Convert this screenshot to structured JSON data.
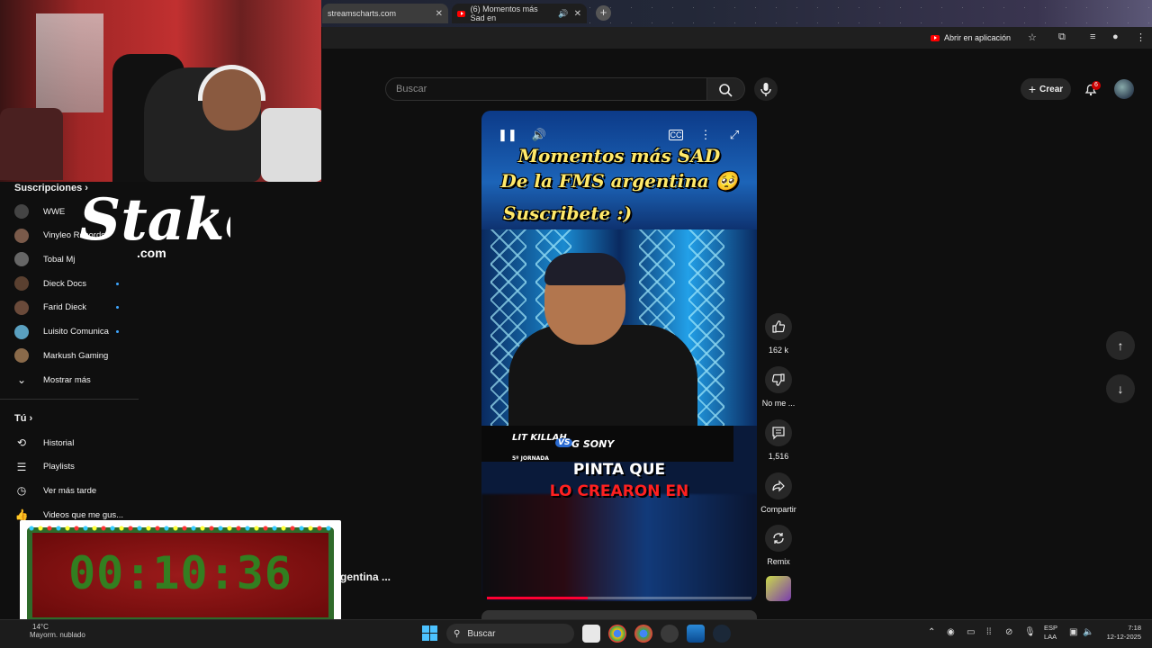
{
  "browser": {
    "tabs": [
      {
        "label": "streamscharts.com"
      },
      {
        "label": "(6) Momentos más Sad en"
      }
    ],
    "open_in_app": "Abrir en aplicación"
  },
  "header": {
    "search_placeholder": "Buscar",
    "create_label": "Crear",
    "notifications_count": "6"
  },
  "sidebar": {
    "subscriptions_title": "Suscripciones",
    "subscriptions": [
      {
        "label": "WWE",
        "new": false,
        "color": "#444"
      },
      {
        "label": "Vinyleo Records",
        "new": false,
        "color": "#7a5a4a"
      },
      {
        "label": "Tobal Mj",
        "new": false,
        "color": "#666"
      },
      {
        "label": "Dieck Docs",
        "new": true,
        "color": "#5a4030"
      },
      {
        "label": "Farid Dieck",
        "new": true,
        "color": "#6a4a3a"
      },
      {
        "label": "Luisito Comunica",
        "new": true,
        "color": "#5aa0c0"
      },
      {
        "label": "Markush Gaming",
        "new": false,
        "color": "#8a6a4a"
      }
    ],
    "show_more": "Mostrar más",
    "you_title": "Tú",
    "you_items": [
      {
        "label": "Historial",
        "icon": "history-icon",
        "glyph": "⟲"
      },
      {
        "label": "Playlists",
        "icon": "playlist-icon",
        "glyph": "☰"
      },
      {
        "label": "Ver más tarde",
        "icon": "clock-icon",
        "glyph": "◷"
      },
      {
        "label": "Videos que me gus...",
        "icon": "like-icon",
        "glyph": "👍"
      }
    ]
  },
  "overlay": {
    "stake_brand": "Stake",
    "stake_tld": ".com",
    "timer": "00:10:36"
  },
  "video": {
    "title_line1": "Momentos más SAD",
    "title_line2": "De la FMS argentina 🥺",
    "title_line3": "Suscribete :)",
    "battle_left": "LIT KILLAH",
    "battle_vs": "VS",
    "battle_right": "G SONY",
    "jornada": "5º JORNADA",
    "caption1": "PINTA QUE",
    "caption2": "LO CREARON EN",
    "progress_fraction": 0.38,
    "partial_title": "gentina ..."
  },
  "actions": {
    "likes": "162 k",
    "dislike": "No me ...",
    "comments": "1,516",
    "share": "Compartir",
    "remix": "Remix"
  },
  "taskbar": {
    "weather_temp": "14°C",
    "weather_desc": "Mayorm. nublado",
    "search": "Buscar",
    "lang1": "ESP",
    "lang2": "LAA",
    "time": "7:18",
    "date": "12-12-2025"
  }
}
